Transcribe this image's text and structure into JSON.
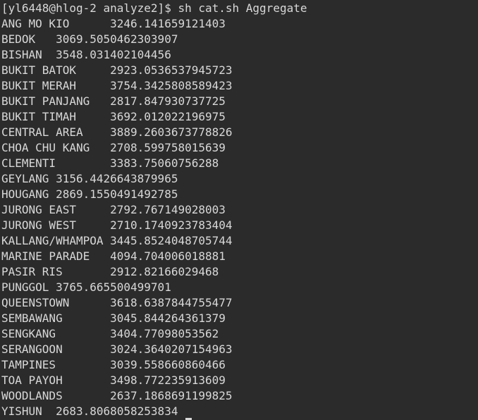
{
  "terminal": {
    "prompt": "[yl6448@hlog-2 analyze2]$ ",
    "command": "sh cat.sh Aggregate",
    "output": [
      "ANG MO KIO      3246.141659121403",
      "BEDOK   3069.5050462303907",
      "BISHAN  3548.031402104456",
      "BUKIT BATOK     2923.0536537945723",
      "BUKIT MERAH     3754.3425808589423",
      "BUKIT PANJANG   2817.847930737725",
      "BUKIT TIMAH     3692.012022196975",
      "CENTRAL AREA    3889.2603673778826",
      "CHOA CHU KANG   2708.599758015639",
      "CLEMENTI        3383.75060756288",
      "GEYLANG 3156.4426643879965",
      "HOUGANG 2869.1550491492785",
      "JURONG EAST     2792.767149028003",
      "JURONG WEST     2710.1740923783404",
      "KALLANG/WHAMPOA 3445.8524048705744",
      "MARINE PARADE   4094.704006018881",
      "PASIR RIS       2912.82166029468",
      "PUNGGOL 3765.665500499701",
      "QUEENSTOWN      3618.6387844755477",
      "SEMBAWANG       3045.844264361379",
      "SENGKANG        3404.77098053562",
      "SERANGOON       3024.3640207154963",
      "TAMPINES        3039.558660860466",
      "TOA PAYOH       3498.772235913609",
      "WOODLANDS       2637.1868691199825",
      "YISHUN  2683.8068058253834"
    ]
  }
}
